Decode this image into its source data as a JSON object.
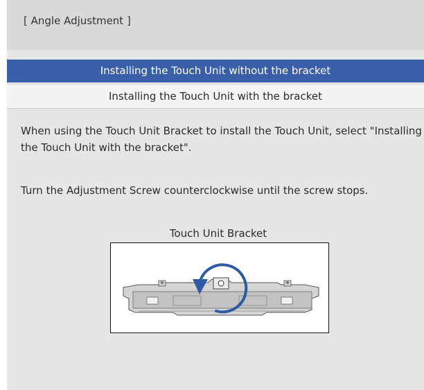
{
  "header": {
    "title": "[ Angle Adjustment ]"
  },
  "menu": {
    "items": [
      {
        "label": "Installing the Touch Unit without the bracket",
        "selected": true
      },
      {
        "label": "Installing the Touch Unit with the bracket",
        "selected": false
      }
    ]
  },
  "content": {
    "description1": "When using the Touch Unit Bracket to install the Touch Unit, select \"Installing the Touch Unit with the bracket\".",
    "description2": "Turn the Adjustment Screw counterclockwise until the screw stops.",
    "image_caption": "Touch Unit Bracket"
  },
  "colors": {
    "panel_bg": "#e6e6e6",
    "header_bg": "#d9d9d9",
    "selected_bg": "#3a5fa9",
    "arrow": "#2d5ba3"
  },
  "icons": {
    "rotation": "counterclockwise-arrow-icon"
  }
}
